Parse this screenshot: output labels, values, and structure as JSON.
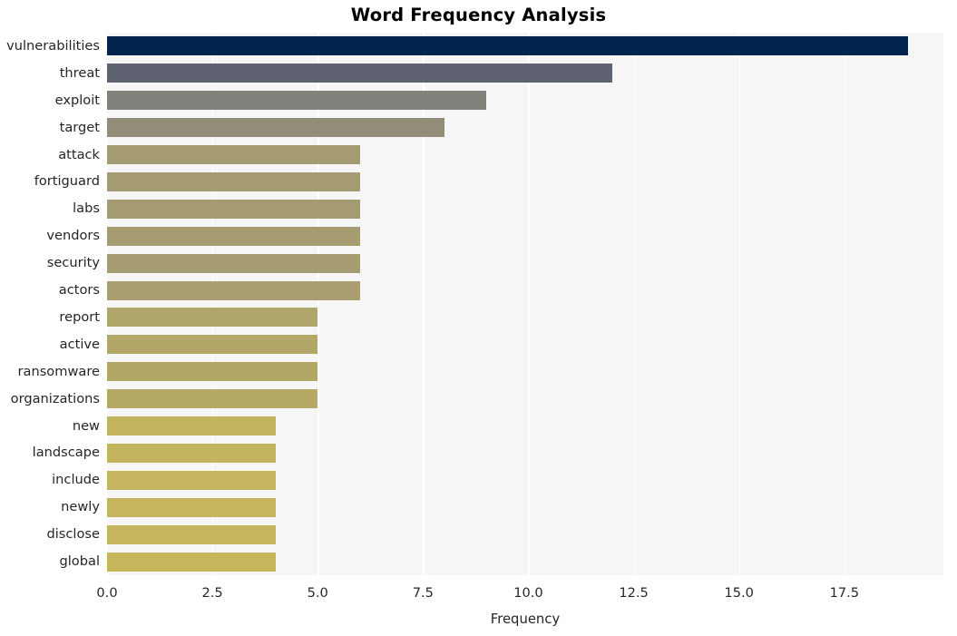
{
  "chart_data": {
    "type": "bar",
    "orientation": "horizontal",
    "title": "Word Frequency Analysis",
    "xlabel": "Frequency",
    "ylabel": "",
    "categories": [
      "vulnerabilities",
      "threat",
      "exploit",
      "target",
      "attack",
      "fortiguard",
      "labs",
      "vendors",
      "security",
      "actors",
      "report",
      "active",
      "ransomware",
      "organizations",
      "new",
      "landscape",
      "include",
      "newly",
      "disclose",
      "global"
    ],
    "values": [
      19,
      12,
      9,
      8,
      6,
      6,
      6,
      6,
      6,
      6,
      5,
      5,
      5,
      5,
      4,
      4,
      4,
      4,
      4,
      4
    ],
    "bar_colors": [
      "#02254e",
      "#5f6270",
      "#83817b",
      "#928d79",
      "#a49b73",
      "#a49b73",
      "#a49b73",
      "#a69c72",
      "#a69c72",
      "#a89e70",
      "#b0a56a",
      "#b2a668",
      "#b3a767",
      "#b5a965",
      "#c2b35f",
      "#c3b45e",
      "#c4b55e",
      "#c5b65d",
      "#c5b65d",
      "#c6b75c"
    ],
    "xticks": [
      "0.0",
      "2.5",
      "5.0",
      "7.5",
      "10.0",
      "12.5",
      "15.0",
      "17.5"
    ],
    "xtick_values": [
      0.0,
      2.5,
      5.0,
      7.5,
      10.0,
      12.5,
      15.0,
      17.5
    ],
    "xlim": [
      0,
      19.85
    ],
    "grid": "vertical",
    "legend": "none",
    "plot_background": "#f6f6f6",
    "gridline_color": "#ffffff",
    "title_color": "#000000",
    "tick_label_color": "#262626"
  }
}
